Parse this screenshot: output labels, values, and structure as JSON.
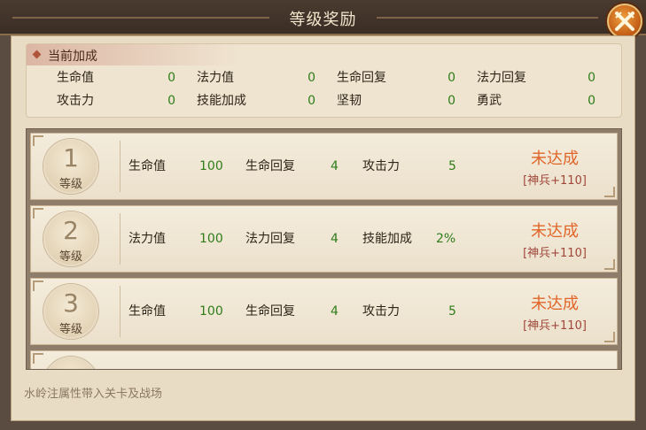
{
  "window": {
    "title": "等级奖励",
    "close_icon": "close-crossed-swords-icon"
  },
  "current_bonus": {
    "header": "当前加成",
    "stats": [
      {
        "label": "生命值",
        "value": "0"
      },
      {
        "label": "法力值",
        "value": "0"
      },
      {
        "label": "生命回复",
        "value": "0"
      },
      {
        "label": "法力回复",
        "value": "0"
      },
      {
        "label": "攻击力",
        "value": "0"
      },
      {
        "label": "技能加成",
        "value": "0"
      },
      {
        "label": "坚韧",
        "value": "0"
      },
      {
        "label": "勇武",
        "value": "0"
      }
    ]
  },
  "levels": [
    {
      "number": "1",
      "level_label": "等级",
      "stats": [
        {
          "label": "生命值",
          "value": "100"
        },
        {
          "label": "生命回复",
          "value": "4"
        },
        {
          "label": "攻击力",
          "value": "5"
        }
      ],
      "status": "未达成",
      "requirement": "[神兵+110]"
    },
    {
      "number": "2",
      "level_label": "等级",
      "stats": [
        {
          "label": "法力值",
          "value": "100"
        },
        {
          "label": "法力回复",
          "value": "4"
        },
        {
          "label": "技能加成",
          "value": "2%"
        }
      ],
      "status": "未达成",
      "requirement": "[神兵+110]"
    },
    {
      "number": "3",
      "level_label": "等级",
      "stats": [
        {
          "label": "生命值",
          "value": "100"
        },
        {
          "label": "生命回复",
          "value": "4"
        },
        {
          "label": "攻击力",
          "value": "5"
        }
      ],
      "status": "未达成",
      "requirement": "[神兵+110]"
    }
  ],
  "footer_note": "水岭注属性带入关卡及战场",
  "colors": {
    "value_green": "#2e7d1a",
    "status_orange": "#e0662a",
    "requirement_red": "#a0463a"
  }
}
